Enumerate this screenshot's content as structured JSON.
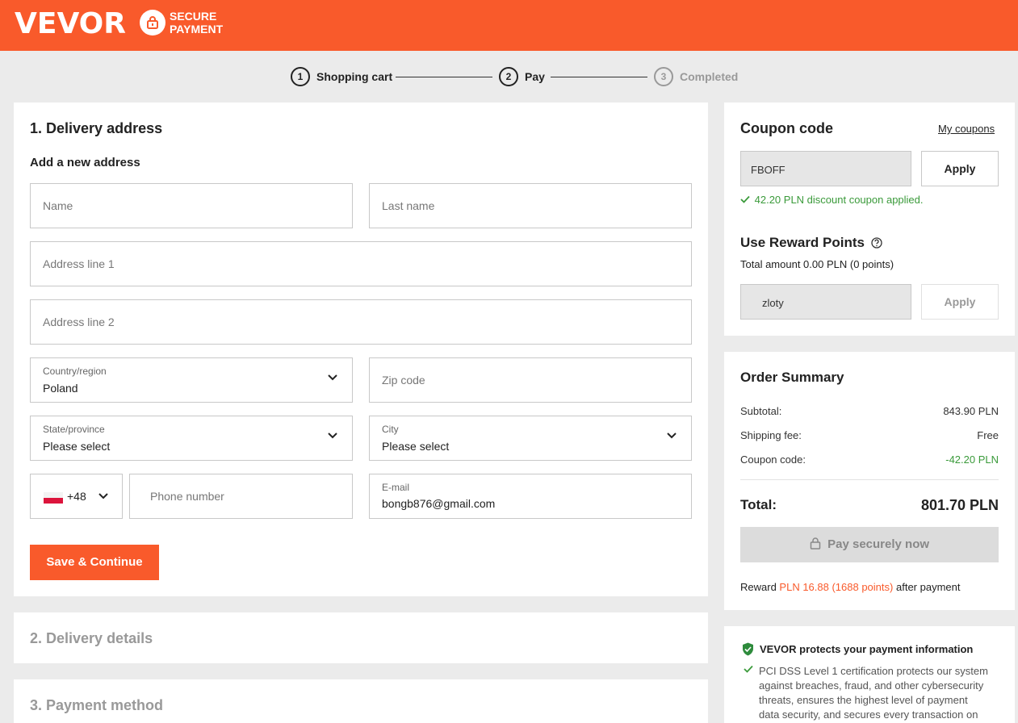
{
  "header": {
    "logo": "VEVOR",
    "secure_line1": "SECURE",
    "secure_line2": "PAYMENT"
  },
  "steps": [
    {
      "num": "1",
      "label": "Shopping cart",
      "state": "done"
    },
    {
      "num": "2",
      "label": "Pay",
      "state": "active"
    },
    {
      "num": "3",
      "label": "Completed",
      "state": "pending"
    }
  ],
  "delivery": {
    "title": "1. Delivery address",
    "subtitle": "Add a new address",
    "name_placeholder": "Name",
    "lastname_placeholder": "Last name",
    "address1_placeholder": "Address line 1",
    "address2_placeholder": "Address line 2",
    "country_label": "Country/region",
    "country_value": "Poland",
    "zip_placeholder": "Zip code",
    "state_label": "State/province",
    "state_value": "Please select",
    "city_label": "City",
    "city_value": "Please select",
    "phone_code": "+48",
    "phone_placeholder": "Phone number",
    "email_label": "E-mail",
    "email_value": "bongb876@gmail.com",
    "save_button": "Save & Continue"
  },
  "sections": {
    "delivery_details": "2. Delivery details",
    "payment_method": "3. Payment method"
  },
  "coupon": {
    "title": "Coupon code",
    "my_coupons": "My coupons",
    "code_value": "FBOFF",
    "apply": "Apply",
    "applied_message": "42.20 PLN discount coupon applied."
  },
  "reward": {
    "title": "Use Reward Points",
    "total": "Total amount 0.00 PLN (0 points)",
    "input_value": "zloty",
    "apply": "Apply"
  },
  "summary": {
    "title": "Order Summary",
    "subtotal_label": "Subtotal:",
    "subtotal_value": "843.90 PLN",
    "shipping_label": "Shipping fee:",
    "shipping_value": "Free",
    "coupon_label": "Coupon code:",
    "coupon_value": "-42.20 PLN",
    "total_label": "Total:",
    "total_value": "801.70 PLN",
    "pay_button": "Pay securely now",
    "reward_prefix": "Reward",
    "reward_amount": "PLN 16.88 (1688 points)",
    "reward_suffix": "after payment"
  },
  "protection": {
    "title": "VEVOR protects your payment information",
    "line1": "PCI DSS Level 1 certification protects our system",
    "line2": "against breaches, fraud, and other cybersecurity",
    "line3": "threats, ensures the highest level of payment",
    "line4": "data security, and secures every transaction on"
  },
  "colors": {
    "brand": "#f95a2b",
    "success": "#3a9a3a"
  }
}
